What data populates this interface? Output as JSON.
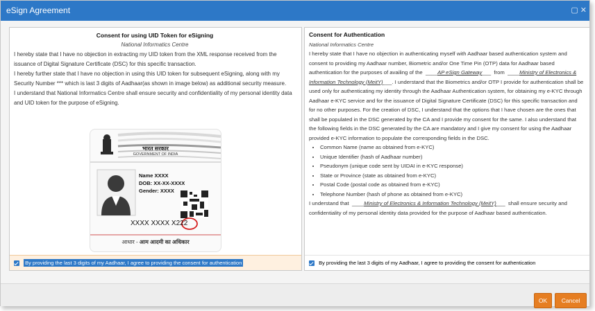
{
  "window": {
    "title": "eSign Agreement",
    "controls": "▢ ✕"
  },
  "left": {
    "heading": "Consent for using UID Token for eSigning",
    "org": "National Informatics Centre",
    "p1": "I hereby state that I have no objection in extracting my UID token from the XML response received from the issuance of Digital Signature Certificate (DSC) for this specific transaction.",
    "p2": "I hereby further state that I have no objection in using this UID token for subsequent eSigning, along with my Security Number *** which is last 3 digits of Aadhaar(as shown in image below) as additional security measure.",
    "p3": "I understand that National Informatics Centre shall ensure security and confidentiality of my personal identity data and UID token for the purpose of eSigning.",
    "card": {
      "hindi_gov": "भारत सरकार",
      "gov": "GOVERNMENT OF INDIA",
      "name": "Name XXXX",
      "dob": "DOB: XX-XX-XXXX",
      "gender": "Gender: XXXX",
      "number_prefix": "XXXX XXXX X",
      "number_last3": "222",
      "footer_hindi_a": "आधार -",
      "footer_hindi_b": "आम आदमी का अधिकार"
    },
    "consent": "By providing the last 3 digits of my Aadhaar, I agree to providing the consent for authentication"
  },
  "right": {
    "heading": "Consent for Authentication",
    "org": "National Informatics Centre",
    "p1_a": "I hereby state that I have no objection in authenticating myself with Aadhaar based authentication system and consent to providing my Aadhaar number, Biometric and/or One Time Pin (OTP) data for Aadhaar based authentication for the purposes of availing of the",
    "gateway": "AP eSign Gateway",
    "p1_b": "from",
    "ministry": "Ministry of Electronics & Information Technology (MeitY)",
    "p1_c": ". I understand that the Biometrics and/or OTP I provide for authentication shall be used only for authenticating my identity through the Aadhaar Authentication system, for obtaining my e-KYC through Aadhaar e-KYC service and for the issuance of Digital Signature Certificate (DSC) for this specific transaction and for no other purposes. For the creation of DSC, I understand that the options that I have chosen are the ones that shall be populated in the DSC generated by the CA and I provide my consent for the same. I also understand that the following fields in the DSC generated by the CA are mandatory and I give my consent for using the Aadhaar provided e-KYC information to populate the corresponding fields in the DSC.",
    "fields": [
      "Common Name (name as obtained from e-KYC)",
      "Unique Identifier (hash of Aadhaar number)",
      "Pseudonym (unique code sent by UIDAI in e-KYC response)",
      "State or Province (state as obtained from e-KYC)",
      "Postal Code (postal code as obtained from e-KYC)",
      "Telephone Number (hash of phone as obtained from e-KYC)"
    ],
    "p2_a": "I understand that",
    "ministry2": "Ministry of Electronics & Information Technology (MeitY)",
    "p2_b": "shall ensure security and confidentiality of my personal identity data provided for the purpose of Aadhaar based authentication.",
    "consent": "By providing the last 3 digits of my Aadhaar, I agree to providing the consent for authentication"
  },
  "buttons": {
    "ok": "OK",
    "cancel": "Cancel"
  },
  "colors": {
    "titlebar": "#2d78c7",
    "button": "#e67e22",
    "consent_bg": "#fef0e0"
  }
}
